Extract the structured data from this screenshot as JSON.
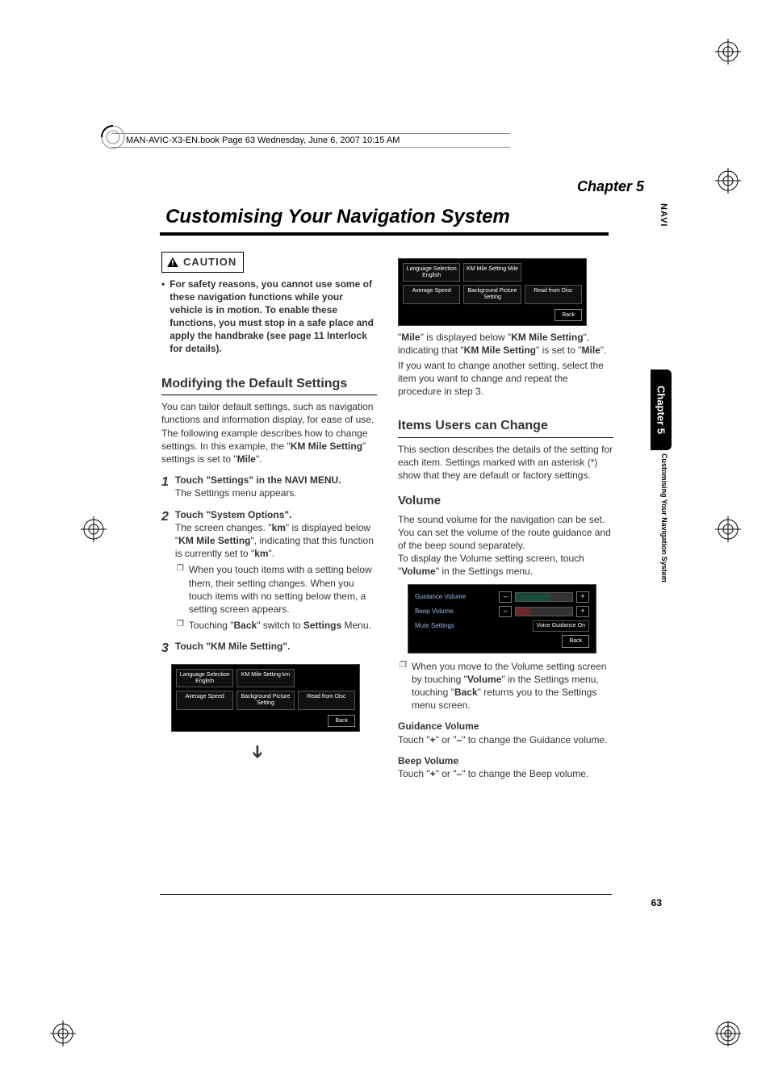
{
  "book_header": "MAN-AVIC-X3-EN.book  Page 63  Wednesday, June 6, 2007  10:15 AM",
  "chapter_label": "Chapter 5",
  "page_title": "Customising Your Navigation System",
  "vert_navi": "NAVI",
  "caution_label": "CAUTION",
  "caution_text": "For safety reasons, you cannot use some of these navigation functions while your vehicle is in motion. To enable these functions, you must stop in a safe place and apply the handbrake (see page 11 Interlock for details).",
  "sec_modify": "Modifying the Default Settings",
  "modify_p1": "You can tailor default settings, such as navigation functions and information display, for ease of use.",
  "modify_p2_a": "The following example describes how to change settings. In this example, the \"",
  "modify_p2_b": "KM Mile Setting",
  "modify_p2_c": "\" settings is set to \"",
  "modify_p2_d": "Mile",
  "modify_p2_e": "\".",
  "step1_num": "1",
  "step1_title": "Touch \"Settings\" in the NAVI MENU.",
  "step1_body": "The Settings menu appears.",
  "step2_num": "2",
  "step2_title": "Touch \"System Options\".",
  "step2_body_a": "The screen changes. \"",
  "step2_body_b": "km",
  "step2_body_c": "\" is displayed below \"",
  "step2_body_d": "KM Mile Setting",
  "step2_body_e": "\", indicating that this function is currently set to \"",
  "step2_body_f": "km",
  "step2_body_g": "\".",
  "step2_sub1": "When you touch items with a setting below them, their setting changes. When you touch items with no setting below them, a setting screen appears.",
  "step2_sub2_a": "Touching \"",
  "step2_sub2_b": "Back",
  "step2_sub2_c": "\" switch to ",
  "step2_sub2_d": "Settings",
  "step2_sub2_e": " Menu.",
  "step3_num": "3",
  "step3_title": "Touch \"KM Mile Setting\".",
  "shot1": {
    "r1c1": "Language Selection English",
    "r1c2": "KM Mile Setting km",
    "r2c1": "Average Speed",
    "r2c2": "Background Picture Setting",
    "r2c3": "Read from Disc",
    "back": "Back"
  },
  "shot2": {
    "r1c1": "Language Selection English",
    "r1c2": "KM Mile Setting Mile",
    "r2c1": "Average Speed",
    "r2c2": "Background Picture Setting",
    "r2c3": "Read from Disc",
    "back": "Back"
  },
  "after_shot_a": "\"",
  "after_shot_b": "Mile",
  "after_shot_c": "\" is displayed below \"",
  "after_shot_d": "KM Mile Setting",
  "after_shot_e": "\", indicating that \"",
  "after_shot_f": "KM Mile Setting",
  "after_shot_g": "\" is set to \"",
  "after_shot_h": "Mile",
  "after_shot_i": "\".",
  "after_shot_p2": "If you want to change another setting, select the item you want to change and repeat the procedure in step 3.",
  "sec_items": "Items Users can Change",
  "items_p1": "This section describes the details of the setting for each item. Settings marked with an asterisk (*) show that they are default or factory settings.",
  "sub_volume": "Volume",
  "vol_p1": "The sound volume for the navigation can be set. You can set the volume of the route guidance and of the beep sound separately.",
  "vol_p2_a": "To display the Volume setting screen, touch \"",
  "vol_p2_b": "Volume",
  "vol_p2_c": "\" in the Settings menu.",
  "volshot": {
    "row1": "Guidance Volume",
    "row2": "Beep Volume",
    "row3": "Mute Settings",
    "voice": "Voice Guidance On",
    "back": "Back",
    "minus": "–",
    "plus": "+"
  },
  "vol_sub_a": "When you move to the Volume setting screen by touching \"",
  "vol_sub_b": "Volume",
  "vol_sub_c": "\" in the Settings menu, touching \"",
  "vol_sub_d": "Back",
  "vol_sub_e": "\" returns you to the Settings menu screen.",
  "gv_h": "Guidance Volume",
  "gv_body_a": "Touch \"",
  "gv_body_b": "+",
  "gv_body_c": "\" or \"",
  "gv_body_d": "–",
  "gv_body_e": "\" to change the Guidance volume.",
  "bv_h": "Beep Volume",
  "bv_body_a": "Touch \"",
  "bv_body_b": "+",
  "bv_body_c": "\" or \"",
  "bv_body_d": "–",
  "bv_body_e": "\" to change the Beep volume.",
  "side_tab": "Chapter 5",
  "side_tab_sub": "Customising Your Navigation System",
  "page_num": "63"
}
